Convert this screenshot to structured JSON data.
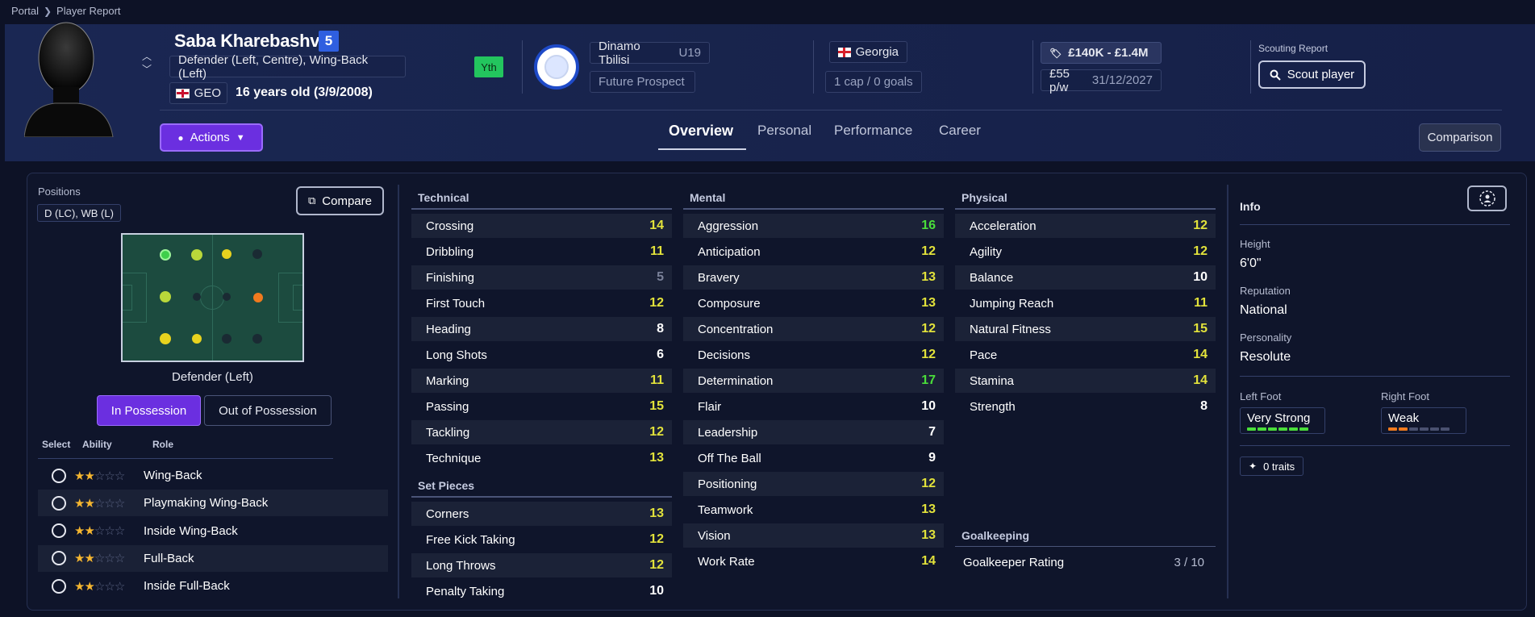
{
  "breadcrumb": {
    "root": "Portal",
    "current": "Player Report"
  },
  "player": {
    "name": "Saba Kharebashvili",
    "ability": "5",
    "positions": "Defender (Left, Centre), Wing-Back (Left)",
    "nationality_code": "GEO",
    "age": "16 years old (3/9/2008)",
    "youth_badge": "Yth"
  },
  "club": {
    "name": "Dinamo Tbilisi",
    "team": "U19",
    "status": "Future Prospect"
  },
  "nation": {
    "name": "Georgia",
    "caps": "1 cap / 0 goals"
  },
  "contract": {
    "value": "£140K - £1.4M",
    "wage": "£55 p/w",
    "expiry": "31/12/2027"
  },
  "scouting": {
    "label": "Scouting Report",
    "button": "Scout player"
  },
  "actions_label": "Actions",
  "tabs": [
    "Overview",
    "Personal",
    "Performance",
    "Career"
  ],
  "comparison_label": "Comparison",
  "positions_panel": {
    "label": "Positions",
    "short": "D (LC), WB (L)",
    "compare_label": "Compare",
    "selected_position": "Defender (Left)",
    "in_possession": "In Possession",
    "out_possession": "Out of Possession",
    "headers": {
      "select": "Select",
      "ability": "Ability",
      "role": "Role"
    },
    "roles": [
      {
        "name": "Wing-Back",
        "stars": 2
      },
      {
        "name": "Playmaking Wing-Back",
        "stars": 2
      },
      {
        "name": "Inside Wing-Back",
        "stars": 2
      },
      {
        "name": "Full-Back",
        "stars": 2
      },
      {
        "name": "Inside Full-Back",
        "stars": 2
      }
    ],
    "pitch_dot_colors": [
      "#3fcf4a",
      "#b9d83a",
      "#e8d21e",
      "#f07a1e",
      "#1a2a33"
    ]
  },
  "technical": {
    "title": "Technical",
    "attrs": [
      {
        "name": "Crossing",
        "value": "14",
        "tone": "yellow"
      },
      {
        "name": "Dribbling",
        "value": "11",
        "tone": "yellow"
      },
      {
        "name": "Finishing",
        "value": "5",
        "tone": "grey"
      },
      {
        "name": "First Touch",
        "value": "12",
        "tone": "yellow"
      },
      {
        "name": "Heading",
        "value": "8",
        "tone": "white"
      },
      {
        "name": "Long Shots",
        "value": "6",
        "tone": "white"
      },
      {
        "name": "Marking",
        "value": "11",
        "tone": "yellow"
      },
      {
        "name": "Passing",
        "value": "15",
        "tone": "yellow"
      },
      {
        "name": "Tackling",
        "value": "12",
        "tone": "yellow"
      },
      {
        "name": "Technique",
        "value": "13",
        "tone": "yellow"
      }
    ]
  },
  "set_pieces": {
    "title": "Set Pieces",
    "attrs": [
      {
        "name": "Corners",
        "value": "13",
        "tone": "yellow"
      },
      {
        "name": "Free Kick Taking",
        "value": "12",
        "tone": "yellow"
      },
      {
        "name": "Long Throws",
        "value": "12",
        "tone": "yellow"
      },
      {
        "name": "Penalty Taking",
        "value": "10",
        "tone": "white"
      }
    ]
  },
  "mental": {
    "title": "Mental",
    "attrs": [
      {
        "name": "Aggression",
        "value": "16",
        "tone": "green"
      },
      {
        "name": "Anticipation",
        "value": "12",
        "tone": "yellow"
      },
      {
        "name": "Bravery",
        "value": "13",
        "tone": "yellow"
      },
      {
        "name": "Composure",
        "value": "13",
        "tone": "yellow"
      },
      {
        "name": "Concentration",
        "value": "12",
        "tone": "yellow"
      },
      {
        "name": "Decisions",
        "value": "12",
        "tone": "yellow"
      },
      {
        "name": "Determination",
        "value": "17",
        "tone": "green"
      },
      {
        "name": "Flair",
        "value": "10",
        "tone": "white"
      },
      {
        "name": "Leadership",
        "value": "7",
        "tone": "white"
      },
      {
        "name": "Off The Ball",
        "value": "9",
        "tone": "white"
      },
      {
        "name": "Positioning",
        "value": "12",
        "tone": "yellow"
      },
      {
        "name": "Teamwork",
        "value": "13",
        "tone": "yellow"
      },
      {
        "name": "Vision",
        "value": "13",
        "tone": "yellow"
      },
      {
        "name": "Work Rate",
        "value": "14",
        "tone": "yellow"
      }
    ]
  },
  "physical": {
    "title": "Physical",
    "attrs": [
      {
        "name": "Acceleration",
        "value": "12",
        "tone": "yellow"
      },
      {
        "name": "Agility",
        "value": "12",
        "tone": "yellow"
      },
      {
        "name": "Balance",
        "value": "10",
        "tone": "white"
      },
      {
        "name": "Jumping Reach",
        "value": "11",
        "tone": "yellow"
      },
      {
        "name": "Natural Fitness",
        "value": "15",
        "tone": "yellow"
      },
      {
        "name": "Pace",
        "value": "14",
        "tone": "yellow"
      },
      {
        "name": "Stamina",
        "value": "14",
        "tone": "yellow"
      },
      {
        "name": "Strength",
        "value": "8",
        "tone": "white"
      }
    ]
  },
  "goalkeeping": {
    "title": "Goalkeeping",
    "label": "Goalkeeper Rating",
    "value": "3 / 10"
  },
  "info": {
    "title": "Info",
    "height_label": "Height",
    "height": "6'0\"",
    "reputation_label": "Reputation",
    "reputation": "National",
    "personality_label": "Personality",
    "personality": "Resolute",
    "left_foot_label": "Left Foot",
    "left_foot": "Very Strong",
    "left_foot_level": 6,
    "right_foot_label": "Right Foot",
    "right_foot": "Weak",
    "right_foot_level": 2,
    "traits": "0 traits"
  },
  "colors": {
    "accent": "#6b2fe0",
    "ability_badge": "#2f5fe0",
    "youth": "#23c55e",
    "attr_green": "#4ade3a",
    "attr_yellow": "#e2e23b"
  }
}
